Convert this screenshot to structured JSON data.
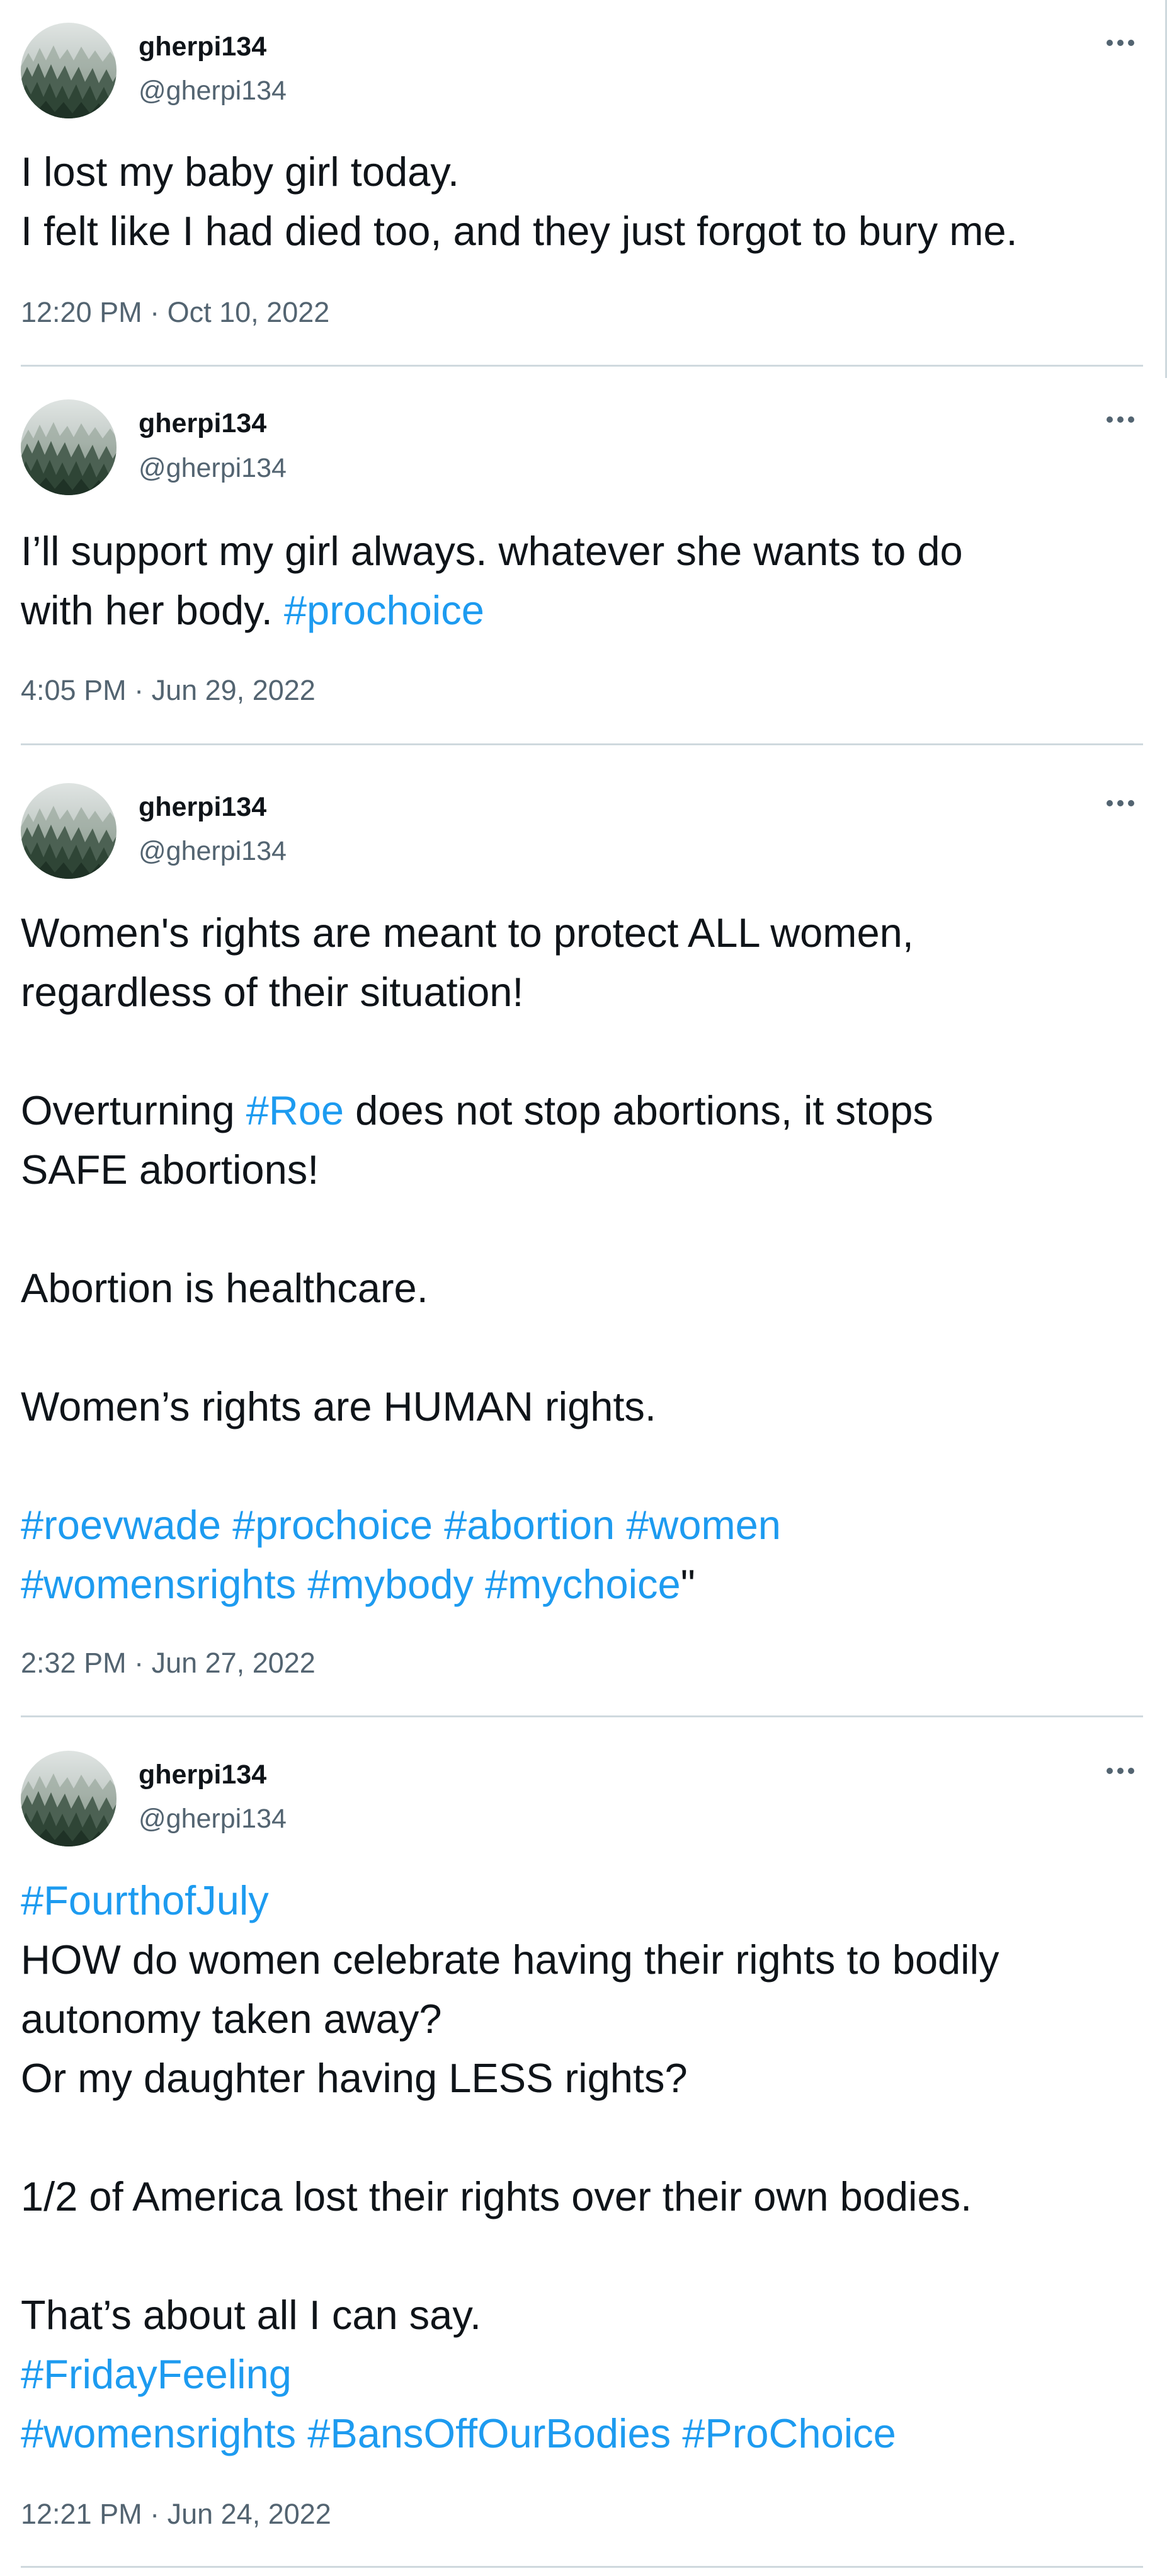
{
  "user": {
    "display_name": "gherpi134",
    "handle": "@gherpi134"
  },
  "colors": {
    "text": "#0f1419",
    "secondary": "#536471",
    "hashtag": "#1d9bf0",
    "divider": "#cfd9de"
  },
  "icons": {
    "avatar": "misty-forest-avatar-image",
    "more": "more-options-icon"
  },
  "tweets": [
    {
      "lines": [
        [
          {
            "t": "I lost my baby girl today."
          }
        ],
        [
          {
            "t": "I felt like I had died too, and they just forgot to bury me."
          }
        ]
      ],
      "timestamp": "12:20 PM · Oct 10, 2022"
    },
    {
      "lines": [
        [
          {
            "t": "I’ll support my girl always. whatever she wants to do"
          }
        ],
        [
          {
            "t": "with her body. "
          },
          {
            "t": "#prochoice",
            "tag": true
          }
        ]
      ],
      "timestamp": "4:05 PM · Jun 29, 2022"
    },
    {
      "lines": [
        [
          {
            "t": "Women's rights are meant to protect ALL women,"
          }
        ],
        [
          {
            "t": "regardless of their situation!"
          }
        ],
        [],
        [
          {
            "t": "Overturning "
          },
          {
            "t": "#Roe",
            "tag": true
          },
          {
            "t": " does not stop abortions, it stops"
          }
        ],
        [
          {
            "t": "SAFE abortions!"
          }
        ],
        [],
        [
          {
            "t": "Abortion is healthcare."
          }
        ],
        [],
        [
          {
            "t": "Women’s rights are HUMAN rights."
          }
        ],
        [],
        [
          {
            "t": "#roevwade",
            "tag": true
          },
          {
            "t": " "
          },
          {
            "t": "#prochoice",
            "tag": true
          },
          {
            "t": " "
          },
          {
            "t": "#abortion",
            "tag": true
          },
          {
            "t": " "
          },
          {
            "t": "#women",
            "tag": true
          }
        ],
        [
          {
            "t": "#womensrights",
            "tag": true
          },
          {
            "t": " "
          },
          {
            "t": "#mybody",
            "tag": true
          },
          {
            "t": " "
          },
          {
            "t": "#mychoice",
            "tag": true
          },
          {
            "t": "\""
          }
        ]
      ],
      "timestamp": "2:32 PM · Jun 27, 2022"
    },
    {
      "lines": [
        [
          {
            "t": "#FourthofJuly",
            "tag": true
          }
        ],
        [
          {
            "t": "HOW do women celebrate having their rights to bodily"
          }
        ],
        [
          {
            "t": "autonomy taken away?"
          }
        ],
        [
          {
            "t": "Or my daughter having LESS rights?"
          }
        ],
        [],
        [
          {
            "t": "1/2 of America lost their rights over their own bodies."
          }
        ],
        [],
        [
          {
            "t": "That’s about all I can say."
          }
        ],
        [
          {
            "t": "#FridayFeeling",
            "tag": true
          }
        ],
        [
          {
            "t": "#womensrights",
            "tag": true
          },
          {
            "t": " "
          },
          {
            "t": "#BansOffOurBodies",
            "tag": true
          },
          {
            "t": " "
          },
          {
            "t": "#ProChoice",
            "tag": true
          }
        ]
      ],
      "timestamp": "12:21 PM · Jun 24, 2022"
    }
  ]
}
